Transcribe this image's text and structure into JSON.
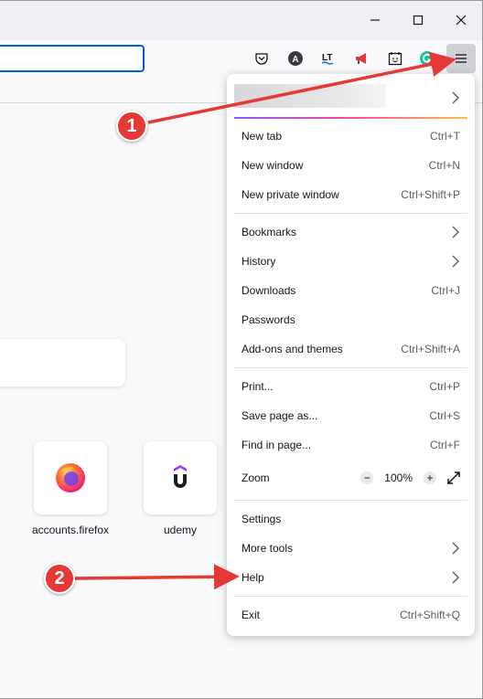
{
  "window": {
    "minimize_icon": "minimize-icon",
    "maximize_icon": "maximize-icon",
    "close_icon": "close-icon"
  },
  "toolbar": {
    "url_value": "",
    "icons": [
      "pocket-icon",
      "account-a-icon",
      "languagetool-icon",
      "megaphone-icon",
      "calendar-smile-icon",
      "grammarly-icon",
      "hamburger-menu-icon"
    ]
  },
  "shortcuts": [
    {
      "label": "accounts.firefox",
      "icon": "firefox-icon"
    },
    {
      "label": "udemy",
      "icon": "udemy-icon"
    }
  ],
  "menu": {
    "new_tab": {
      "label": "New tab",
      "shortcut": "Ctrl+T"
    },
    "new_window": {
      "label": "New window",
      "shortcut": "Ctrl+N"
    },
    "new_private_window": {
      "label": "New private window",
      "shortcut": "Ctrl+Shift+P"
    },
    "bookmarks": {
      "label": "Bookmarks"
    },
    "history": {
      "label": "History"
    },
    "downloads": {
      "label": "Downloads",
      "shortcut": "Ctrl+J"
    },
    "passwords": {
      "label": "Passwords"
    },
    "addons": {
      "label": "Add-ons and themes",
      "shortcut": "Ctrl+Shift+A"
    },
    "print": {
      "label": "Print...",
      "shortcut": "Ctrl+P"
    },
    "save_page": {
      "label": "Save page as...",
      "shortcut": "Ctrl+S"
    },
    "find_in_page": {
      "label": "Find in page...",
      "shortcut": "Ctrl+F"
    },
    "zoom": {
      "label": "Zoom",
      "value": "100%",
      "minus": "−",
      "plus": "+"
    },
    "settings": {
      "label": "Settings"
    },
    "more_tools": {
      "label": "More tools"
    },
    "help": {
      "label": "Help"
    },
    "exit": {
      "label": "Exit",
      "shortcut": "Ctrl+Shift+Q"
    }
  },
  "annotations": {
    "marker1": "1",
    "marker2": "2",
    "color": "#e53935"
  },
  "colors": {
    "accent": "#0061e0",
    "titlebar": "#f0f0f4",
    "page_bg": "#f9f9fb"
  }
}
